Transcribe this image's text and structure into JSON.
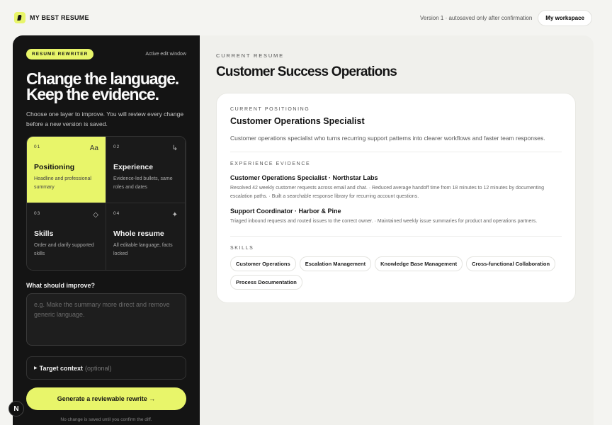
{
  "header": {
    "brand_name": "MY BEST RESUME",
    "version_status": "Version 1 · autosaved only after confirmation",
    "workspace_label": "My workspace"
  },
  "rewriter": {
    "badge": "RESUME REWRITER",
    "active_label": "Active edit window",
    "headline_line1": "Change the language.",
    "headline_line2": "Keep the evidence.",
    "intro": "Choose one layer to improve. You will review every change before a new version is saved.",
    "layers": [
      {
        "num": "01",
        "icon": "Aa",
        "title": "Positioning",
        "desc": "Headline and professional summary",
        "selected": true
      },
      {
        "num": "02",
        "icon": "↳",
        "title": "Experience",
        "desc": "Evidence-led bullets, same roles and dates",
        "selected": false
      },
      {
        "num": "03",
        "icon": "◇",
        "title": "Skills",
        "desc": "Order and clarify supported skills",
        "selected": false
      },
      {
        "num": "04",
        "icon": "✦",
        "title": "Whole resume",
        "desc": "All editable language, facts locked",
        "selected": false
      }
    ],
    "improve_label": "What should improve?",
    "improve_placeholder": "e.g. Make the summary more direct and remove generic language.",
    "target_label": "Target context",
    "target_optional": "(optional)",
    "generate_label": "Generate a reviewable rewrite →",
    "note": "No change is saved until you confirm the diff."
  },
  "resume": {
    "eyebrow": "CURRENT RESUME",
    "title": "Customer Success Operations",
    "positioning_label": "CURRENT POSITIONING",
    "positioning_title": "Customer Operations Specialist",
    "positioning_summary": "Customer operations specialist who turns recurring support patterns into clearer workflows and faster team responses.",
    "experience_label": "EXPERIENCE EVIDENCE",
    "roles": [
      {
        "title": "Customer Operations Specialist · Northstar Labs",
        "bullets": "Resolved 42 weekly customer requests across email and chat. · Reduced average handoff time from 18 minutes to 12 minutes by documenting escalation paths. · Built a searchable response library for recurring account questions."
      },
      {
        "title": "Support Coordinator · Harbor & Pine",
        "bullets": "Triaged inbound requests and routed issues to the correct owner. · Maintained weekly issue summaries for product and operations partners."
      }
    ],
    "skills_label": "SKILLS",
    "skills": [
      "Customer Operations",
      "Escalation Management",
      "Knowledge Base Management",
      "Cross-functional Collaboration",
      "Process Documentation"
    ]
  },
  "floating_badge": "N",
  "colors": {
    "accent": "#e8f56a",
    "dark_panel": "#141414",
    "page_bg": "#f4f4f1"
  }
}
